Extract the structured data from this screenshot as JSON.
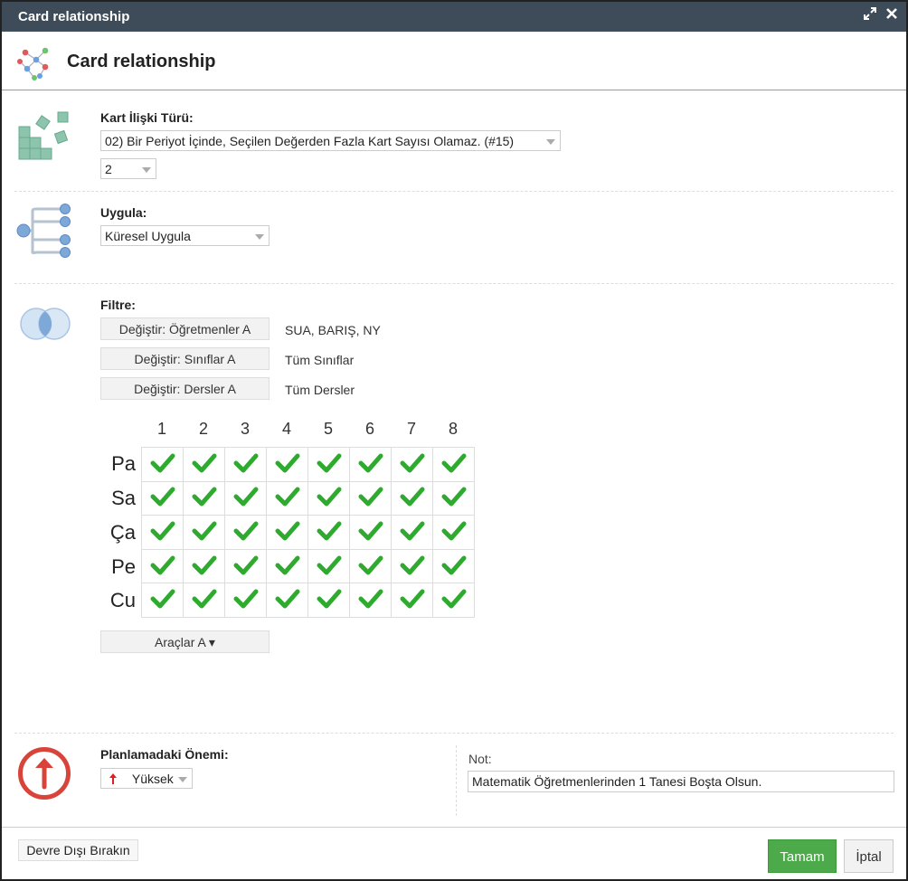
{
  "window": {
    "title": "Card relationship",
    "heading": "Card relationship"
  },
  "relation_type": {
    "label": "Kart İlişki Türü:",
    "selected": "02) Bir Periyot İçinde, Seçilen Değerden Fazla Kart Sayısı Olamaz. (#15)",
    "count_selected": "2"
  },
  "apply": {
    "label": "Uygula:",
    "selected": "Küresel Uygula"
  },
  "filter": {
    "label": "Filtre:",
    "rows": [
      {
        "button": "Değiştir: Öğretmenler A",
        "value": "SUA, BARIŞ, NY"
      },
      {
        "button": "Değiştir: Sınıflar A",
        "value": "Tüm Sınıflar"
      },
      {
        "button": "Değiştir: Dersler A",
        "value": "Tüm Dersler"
      }
    ]
  },
  "grid": {
    "columns": [
      "1",
      "2",
      "3",
      "4",
      "5",
      "6",
      "7",
      "8"
    ],
    "rows": [
      "Pa",
      "Sa",
      "Ça",
      "Pe",
      "Cu"
    ],
    "cell_state": "checked",
    "check_color": "#2eaa2e"
  },
  "tools_button": "Araçlar A ▾",
  "importance": {
    "label": "Planlamadaki Önemi:",
    "selected": "Yüksek",
    "icon": "red-up-arrow-icon"
  },
  "note": {
    "label": "Not:",
    "value": "Matematik Öğretmenlerinden 1 Tanesi Boşta Olsun."
  },
  "footer": {
    "disable_label": "Devre Dışı Bırakın",
    "ok_label": "Tamam",
    "cancel_label": "İptal"
  },
  "colors": {
    "titlebar": "#3d4c58",
    "ok_button": "#4caa4a",
    "icon_green": "#7fb8a0",
    "icon_blue": "#7ea8d8",
    "importance_red": "#d9443a"
  }
}
